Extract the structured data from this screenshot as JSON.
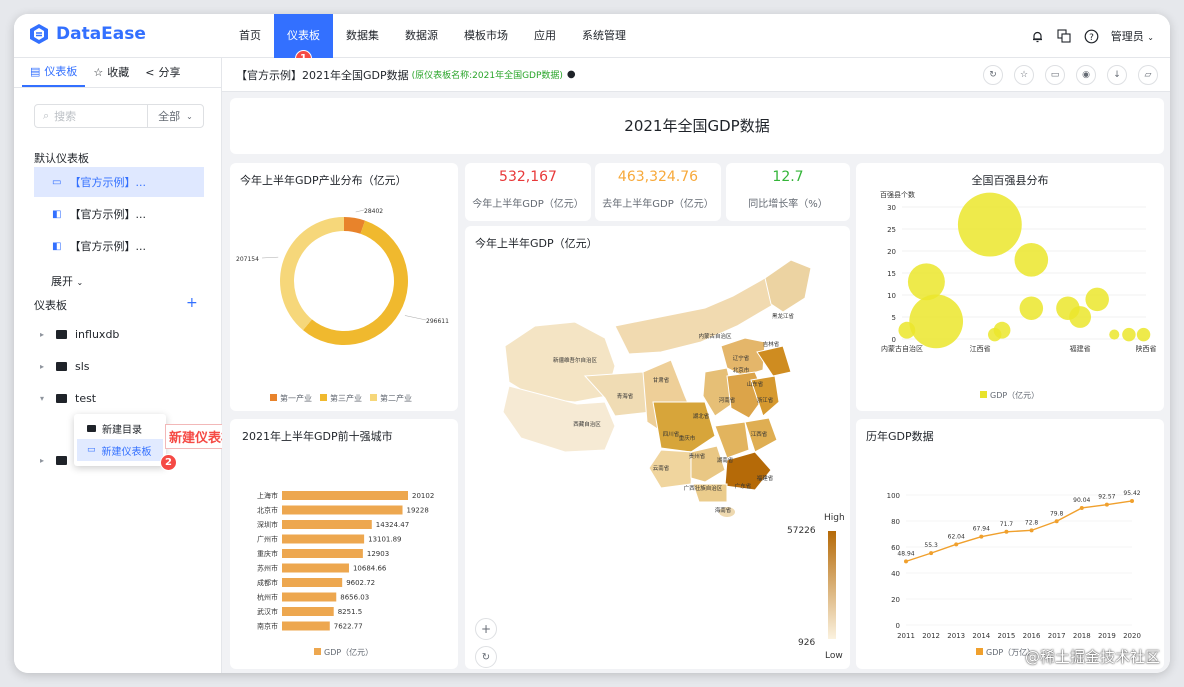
{
  "app": {
    "brand": "DataEase"
  },
  "nav": {
    "items": [
      "首页",
      "仪表板",
      "数据集",
      "数据源",
      "模板市场",
      "应用",
      "系统管理"
    ],
    "active": 1,
    "user": "管理员"
  },
  "sidebar": {
    "tabs": [
      "仪表板",
      "收藏",
      "分享"
    ],
    "search_placeholder": "搜索",
    "filter_value": "全部",
    "default_section": "默认仪表板",
    "default_items": [
      "【官方示例】...",
      "【官方示例】...",
      "【官方示例】..."
    ],
    "expand_label": "展开",
    "dash_section": "仪表板",
    "add_symbol": "+",
    "tree": [
      "influxdb",
      "sls",
      "test"
    ],
    "context_menu": [
      "新建目录",
      "新建仪表板"
    ]
  },
  "annotations": {
    "callout": "新建仪表板",
    "badge1": "1",
    "badge2": "2"
  },
  "main": {
    "header_title": "【官方示例】2021年全国GDP数据",
    "header_sub": "(原仪表板名称:2021年全国GDP数据)",
    "dashboard_title": "2021年全国GDP数据",
    "kpis": [
      {
        "value": "532,167",
        "label": "今年上半年GDP（亿元）",
        "color": "#e8393a"
      },
      {
        "value": "463,324.76",
        "label": "去年上半年GDP（亿元）",
        "color": "#f7a93b"
      },
      {
        "value": "12.7",
        "label": "同比增长率（%）",
        "color": "#34b539"
      }
    ],
    "map": {
      "title": "今年上半年GDP（亿元）",
      "high_label": "High",
      "low_label": "Low",
      "max": "57226",
      "min": "926",
      "provinces": [
        "黑龙江省",
        "吉林省",
        "辽宁省",
        "内蒙古自治区",
        "新疆维吾尔自治区",
        "西藏自治区",
        "青海省",
        "甘肃省",
        "四川省",
        "云南省",
        "贵州省",
        "湖南省",
        "江西省",
        "浙江省",
        "福建省",
        "山东省",
        "河南省",
        "湖北省",
        "广西壮族自治区",
        "广东省",
        "海南省",
        "北京市",
        "重庆市"
      ]
    },
    "watermark": "@稀土掘金技术社区"
  },
  "chart_data": [
    {
      "type": "pie",
      "title": "今年上半年GDP产业分布（亿元）",
      "categories": [
        "第一产业",
        "第三产业",
        "第二产业"
      ],
      "values": [
        28402,
        296611,
        207154
      ],
      "colors": [
        "#e8832b",
        "#f0b92e",
        "#f6d77a"
      ]
    },
    {
      "type": "bar",
      "title": "2021年上半年GDP前十强城市",
      "categories": [
        "上海市",
        "北京市",
        "深圳市",
        "广州市",
        "重庆市",
        "苏州市",
        "成都市",
        "杭州市",
        "武汉市",
        "南京市"
      ],
      "values": [
        20102,
        19228,
        14324.47,
        13101.89,
        12903,
        10684.66,
        9602.72,
        8656.03,
        8251.5,
        7622.77
      ],
      "labels": [
        "20102",
        "19228",
        "14324.47",
        "13101.89",
        "12903",
        "10684.66",
        "9602.72",
        "8656.03",
        "8251.5",
        "7622.77"
      ],
      "legend": "GDP（亿元）"
    },
    {
      "type": "scatter",
      "title": "全国百强县分布",
      "ylabel": "百强县个数",
      "ylim": [
        0,
        30
      ],
      "yticks": [
        0,
        5,
        10,
        15,
        20,
        25,
        30
      ],
      "xticks": [
        "内蒙古自治区",
        "江西省",
        "福建省",
        "陕西省"
      ],
      "legend": "GDP（亿元）",
      "points": [
        {
          "x": 0.02,
          "y": 2,
          "r": 0.1
        },
        {
          "x": 0.1,
          "y": 13,
          "r": 0.22
        },
        {
          "x": 0.14,
          "y": 4,
          "r": 0.32
        },
        {
          "x": 0.36,
          "y": 26,
          "r": 0.38
        },
        {
          "x": 0.38,
          "y": 1,
          "r": 0.08
        },
        {
          "x": 0.41,
          "y": 2,
          "r": 0.1
        },
        {
          "x": 0.53,
          "y": 18,
          "r": 0.2
        },
        {
          "x": 0.53,
          "y": 7,
          "r": 0.14
        },
        {
          "x": 0.68,
          "y": 7,
          "r": 0.14
        },
        {
          "x": 0.73,
          "y": 5,
          "r": 0.13
        },
        {
          "x": 0.8,
          "y": 9,
          "r": 0.14
        },
        {
          "x": 0.87,
          "y": 1,
          "r": 0.06
        },
        {
          "x": 0.93,
          "y": 1,
          "r": 0.08
        },
        {
          "x": 0.99,
          "y": 1,
          "r": 0.08
        }
      ]
    },
    {
      "type": "line",
      "title": "历年GDP数据",
      "x": [
        "2011",
        "2012",
        "2013",
        "2014",
        "2015",
        "2016",
        "2017",
        "2018",
        "2019",
        "2020"
      ],
      "values": [
        48.94,
        55.3,
        62.04,
        67.94,
        71.7,
        72.8,
        79.8,
        90.04,
        92.57,
        95.42
      ],
      "ylim": [
        0,
        100
      ],
      "yticks": [
        0,
        20,
        40,
        60,
        80,
        100
      ],
      "legend": "GDP（万亿）"
    }
  ]
}
